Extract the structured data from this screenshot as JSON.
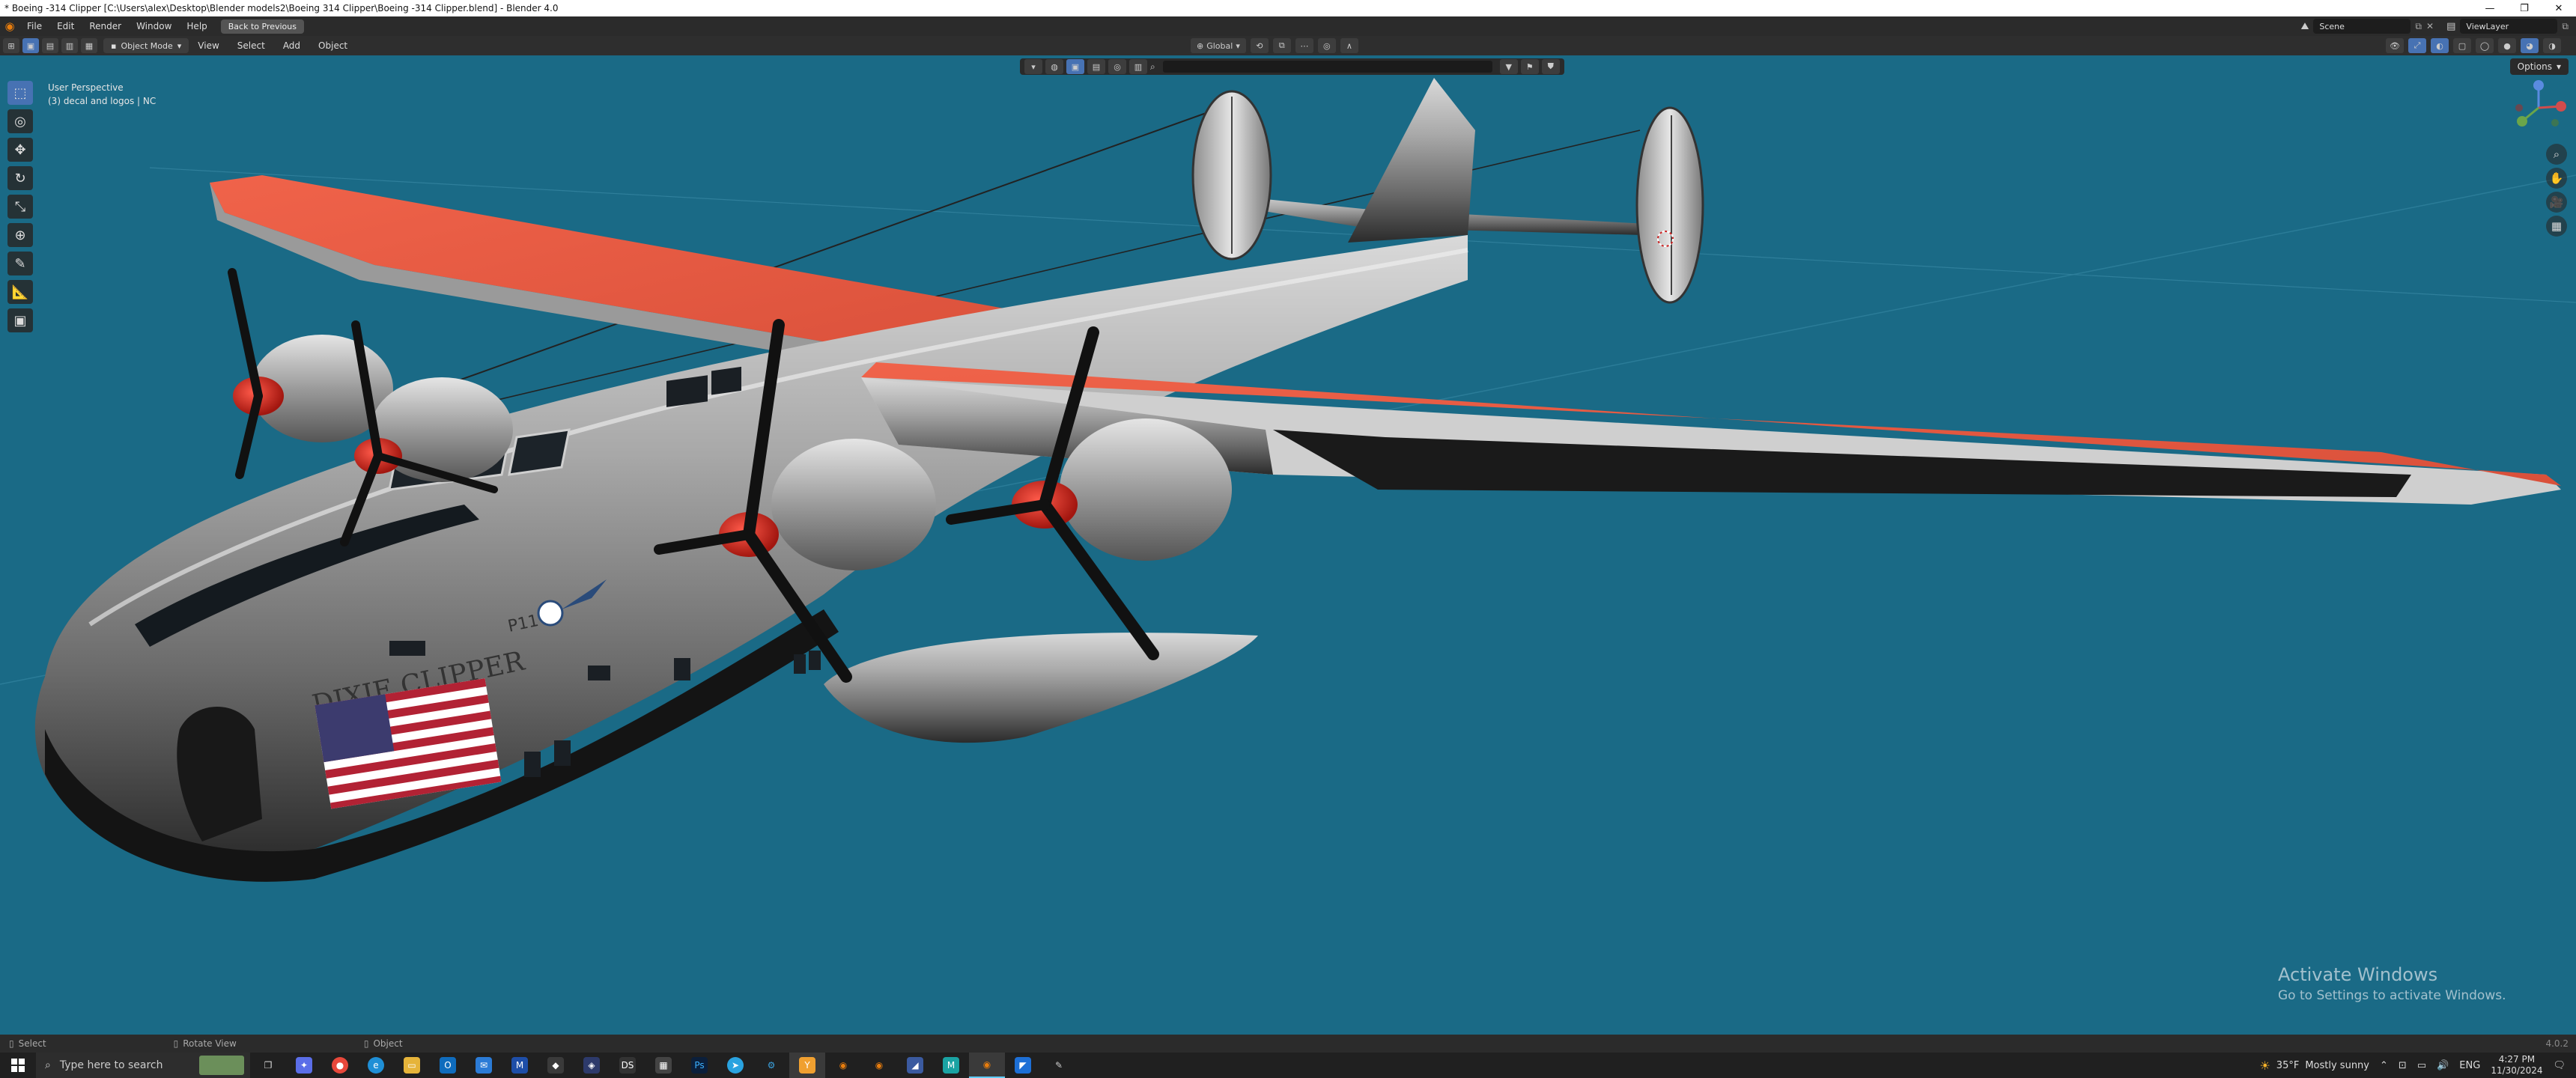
{
  "window": {
    "title": "* Boeing -314 Clipper [C:\\Users\\alex\\Desktop\\Blender models2\\Boeing 314 Clipper\\Boeing -314 Clipper.blend] - Blender 4.0",
    "minimize": "—",
    "maximize": "❐",
    "close": "✕"
  },
  "topbar": {
    "menus": [
      "File",
      "Edit",
      "Render",
      "Window",
      "Help"
    ],
    "back_button": "Back to Previous",
    "scene": "Scene",
    "view_layer": "ViewLayer"
  },
  "viewport_header": {
    "mode": "Object Mode",
    "menus": [
      "View",
      "Select",
      "Add",
      "Object"
    ],
    "orientation": "Global",
    "options": "Options"
  },
  "viewport": {
    "perspective": "User Perspective",
    "collection": "(3) decal and logos | NC",
    "decal_text": "DIXIE CLIPPER",
    "registration": "P11"
  },
  "watermark": {
    "line1": "Activate Windows",
    "line2": "Go to Settings to activate Windows."
  },
  "statusbar": {
    "items": [
      "Select",
      "Rotate View",
      "Object"
    ],
    "version": "4.0.2"
  },
  "taskbar": {
    "search_placeholder": "Type here to search",
    "weather_temp": "35°F",
    "weather_desc": "Mostly sunny",
    "language": "ENG",
    "time": "4:27 PM",
    "date": "11/30/2024"
  },
  "colors": {
    "viewport_bg": "#1a6a86",
    "wing_orange": "#e8583f",
    "blender_orange": "#e87d0d"
  }
}
